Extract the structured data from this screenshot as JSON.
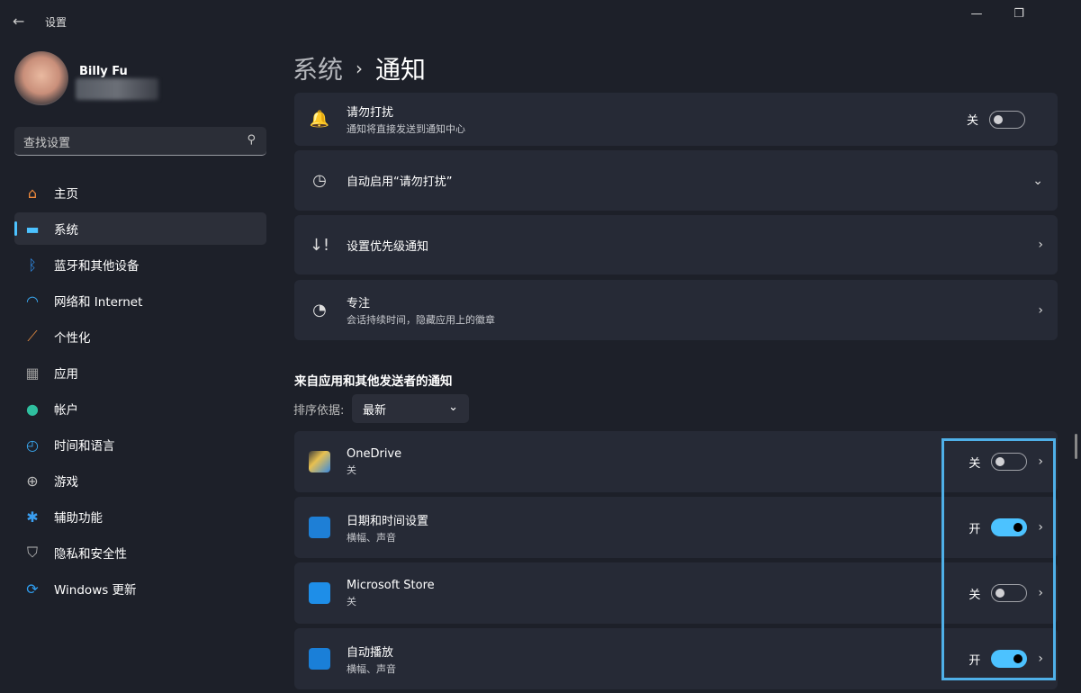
{
  "window": {
    "title": "设置",
    "minimize": "—",
    "restore": "❐"
  },
  "user": {
    "name": "Billy Fu"
  },
  "search": {
    "placeholder": "查找设置"
  },
  "sidebar": {
    "items": [
      {
        "label": "主页",
        "icon": "home-icon"
      },
      {
        "label": "系统",
        "icon": "system-icon",
        "active": true
      },
      {
        "label": "蓝牙和其他设备",
        "icon": "bluetooth-icon"
      },
      {
        "label": "网络和 Internet",
        "icon": "wifi-icon"
      },
      {
        "label": "个性化",
        "icon": "brush-icon"
      },
      {
        "label": "应用",
        "icon": "apps-icon"
      },
      {
        "label": "帐户",
        "icon": "account-icon"
      },
      {
        "label": "时间和语言",
        "icon": "time-language-icon"
      },
      {
        "label": "游戏",
        "icon": "gamepad-icon"
      },
      {
        "label": "辅助功能",
        "icon": "accessibility-icon"
      },
      {
        "label": "隐私和安全性",
        "icon": "shield-icon"
      },
      {
        "label": "Windows 更新",
        "icon": "update-icon"
      }
    ]
  },
  "breadcrumb": {
    "parent": "系统",
    "sep": "›",
    "current": "通知"
  },
  "settings": [
    {
      "title": "请勿打扰",
      "subtitle": "通知将直接发送到通知中心",
      "state": "关",
      "on": false
    },
    {
      "title": "自动启用“请勿打扰”"
    },
    {
      "title": "设置优先级通知"
    },
    {
      "title": "专注",
      "subtitle": "会话持续时间，隐藏应用上的徽章"
    }
  ],
  "apps_section": {
    "title": "来自应用和其他发送者的通知",
    "sort_label": "排序依据:",
    "sort_value": "最新"
  },
  "apps": [
    {
      "name": "OneDrive",
      "subtitle": "关",
      "state": "关",
      "on": false
    },
    {
      "name": "日期和时间设置",
      "subtitle": "横幅、声音",
      "state": "开",
      "on": true
    },
    {
      "name": "Microsoft Store",
      "subtitle": "关",
      "state": "关",
      "on": false
    },
    {
      "name": "自动播放",
      "subtitle": "横幅、声音",
      "state": "开",
      "on": true
    }
  ],
  "colors": {
    "accent": "#4cc2ff",
    "highlight_box": "#4fb0e8",
    "background": "#1d2029",
    "card": "#262a36"
  }
}
